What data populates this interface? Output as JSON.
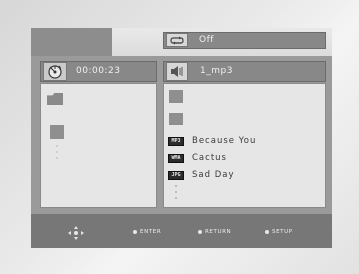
{
  "header": {
    "repeat_icon": "repeat-icon",
    "repeat_value": "Off"
  },
  "left_panel": {
    "time_icon": "disc-clock-icon",
    "time": "00:00:23"
  },
  "right_panel": {
    "track_icon": "speaker-music-icon",
    "track_title": "1_mp3",
    "files": [
      {
        "badge": "MP3",
        "name": "Because You"
      },
      {
        "badge": "WMA",
        "name": "Cactus"
      },
      {
        "badge": "JPG",
        "name": "Sad Day"
      }
    ]
  },
  "footer": {
    "nav_icon": "directional-pad-icon",
    "enter_label": "ENTER",
    "return_label": "RETURN",
    "setup_label": "SETUP"
  }
}
